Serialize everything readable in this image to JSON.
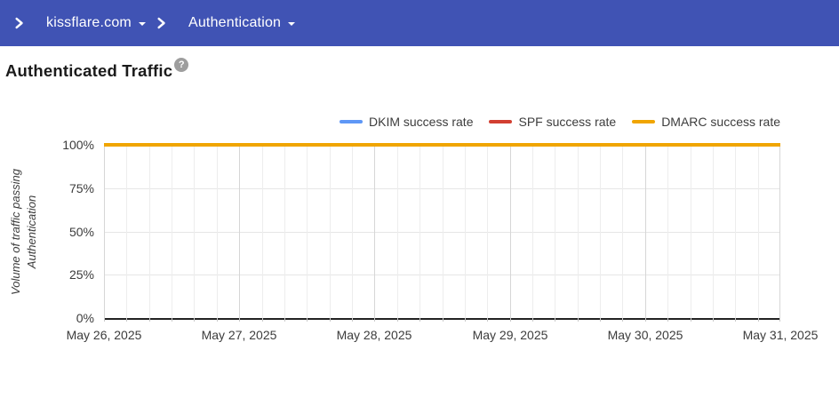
{
  "header": {
    "breadcrumb": [
      {
        "label": "kissflare.com"
      },
      {
        "label": "Authentication"
      }
    ]
  },
  "page": {
    "title": "Authenticated Traffic",
    "help_glyph": "?"
  },
  "colors": {
    "header_bg": "#4053b4",
    "dkim": "#5e97f6",
    "spf": "#d23f31",
    "dmarc": "#f0a500",
    "axis_text": "#3c3c3c",
    "axis_line": "#222222",
    "grid_minor": "#ededed",
    "grid_major": "#d6d6d6",
    "grid_horizontal": "#e6e6e6"
  },
  "chart_data": {
    "type": "line",
    "title": "Authenticated Traffic",
    "x": [
      "May 26, 2025",
      "May 27, 2025",
      "May 28, 2025",
      "May 29, 2025",
      "May 30, 2025",
      "May 31, 2025"
    ],
    "minor_divisions_per_interval": 6,
    "ylabel_lines": [
      "Volume of traffic passing",
      "Authentication"
    ],
    "ylim": [
      0,
      100
    ],
    "yticks": [
      {
        "label": "0%",
        "value": 0
      },
      {
        "label": "25%",
        "value": 25
      },
      {
        "label": "50%",
        "value": 50
      },
      {
        "label": "75%",
        "value": 75
      },
      {
        "label": "100%",
        "value": 100
      }
    ],
    "grid": true,
    "legend_position": "top-right",
    "series": [
      {
        "name": "DKIM success rate",
        "color": "#5e97f6",
        "values": [
          100,
          100,
          100,
          100,
          100,
          100
        ]
      },
      {
        "name": "SPF success rate",
        "color": "#d23f31",
        "values": [
          100,
          100,
          100,
          100,
          100,
          100
        ]
      },
      {
        "name": "DMARC success rate",
        "color": "#f0a500",
        "values": [
          100,
          100,
          100,
          100,
          100,
          100
        ]
      }
    ]
  }
}
